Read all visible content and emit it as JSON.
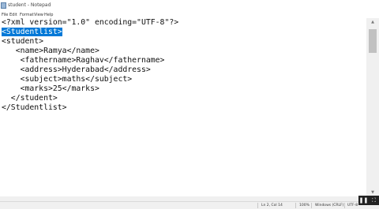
{
  "window": {
    "title": "student - Notepad",
    "app_icon": "notepad-icon"
  },
  "menu": [
    "File",
    "Edit",
    "Format",
    "View",
    "Help"
  ],
  "editor": {
    "lines": [
      "<?xml version=\"1.0\" encoding=\"UTF-8\"?>",
      "<Studentlist>",
      "<student>",
      "   <name>Ramya</name>",
      "    <fathername>Raghav</fathername>",
      "    <address>Hyderabad</address>",
      "    <subject>maths</subject>",
      "    <marks>25</marks>",
      "  </student>",
      "</Studentlist>"
    ],
    "selected_text": "<Studentlist>"
  },
  "statusbar": {
    "position": "Ln 2, Col 14",
    "zoom": "100%",
    "line_ending": "Windows (CRLF)",
    "encoding": "UTF-8"
  },
  "video": {
    "pause_icon": "pause-icon",
    "fullscreen_icon": "fullscreen-icon"
  }
}
